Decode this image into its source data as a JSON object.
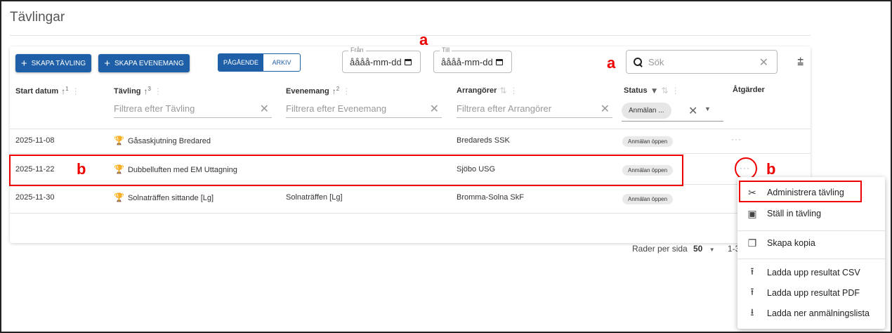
{
  "page": {
    "title": "Tävlingar"
  },
  "toolbar": {
    "create_competition": "SKAPA TÄVLING",
    "create_event": "SKAPA EVENEMANG",
    "toggle_ongoing": "PÅGÅENDE",
    "toggle_archive": "ARKIV",
    "from_label": "Från",
    "from_value": "åååå-mm-dd",
    "to_label": "Till",
    "to_value": "åååå-mm-dd",
    "search_placeholder": "Sök"
  },
  "annotations": {
    "a": "a",
    "b": "b"
  },
  "columns": {
    "start_date": "Start datum",
    "competition": "Tävling",
    "event": "Evenemang",
    "organizers": "Arrangörer",
    "status": "Status",
    "actions": "Åtgärder",
    "sort_1": "1",
    "sort_2": "3",
    "sort_3": "2"
  },
  "filters": {
    "competition": "Filtrera efter Tävling",
    "event": "Filtrera efter Evenemang",
    "organizers": "Filtrera efter Arrangörer",
    "status_chip": "Anmälan ..."
  },
  "rows": [
    {
      "date": "2025-11-08",
      "competition": "Gåsaskjutning Bredared",
      "event": "",
      "organizer": "Bredareds SSK",
      "status": "Anmälan öppen"
    },
    {
      "date": "2025-11-22",
      "competition": "Dubbelluften med EM Uttagning",
      "event": "",
      "organizer": "Sjöbo USG",
      "status": "Anmälan öppen"
    },
    {
      "date": "2025-11-30",
      "competition": "Solnaträffen sittande [Lg]",
      "event": "Solnaträffen [Lg]",
      "organizer": "Bromma-Solna SkF",
      "status": "Anmälan öppen"
    }
  ],
  "footer": {
    "rows_per_page": "Rader per sida",
    "rows_value": "50",
    "range": "1-3"
  },
  "menu": [
    {
      "label": "Administrera tävling",
      "icon": "tools-icon"
    },
    {
      "label": "Ställ in tävling",
      "icon": "calendar-cancel-icon"
    },
    {
      "label": "Skapa kopia",
      "icon": "copy-icon"
    },
    {
      "label": "Ladda upp resultat CSV",
      "icon": "upload-icon"
    },
    {
      "label": "Ladda upp resultat PDF",
      "icon": "upload-icon"
    },
    {
      "label": "Ladda ner anmälningslista",
      "icon": "download-icon"
    }
  ],
  "colors": {
    "primary": "#1e5fa8",
    "annotation": "#ee0000",
    "trophy": "#e8a317"
  }
}
